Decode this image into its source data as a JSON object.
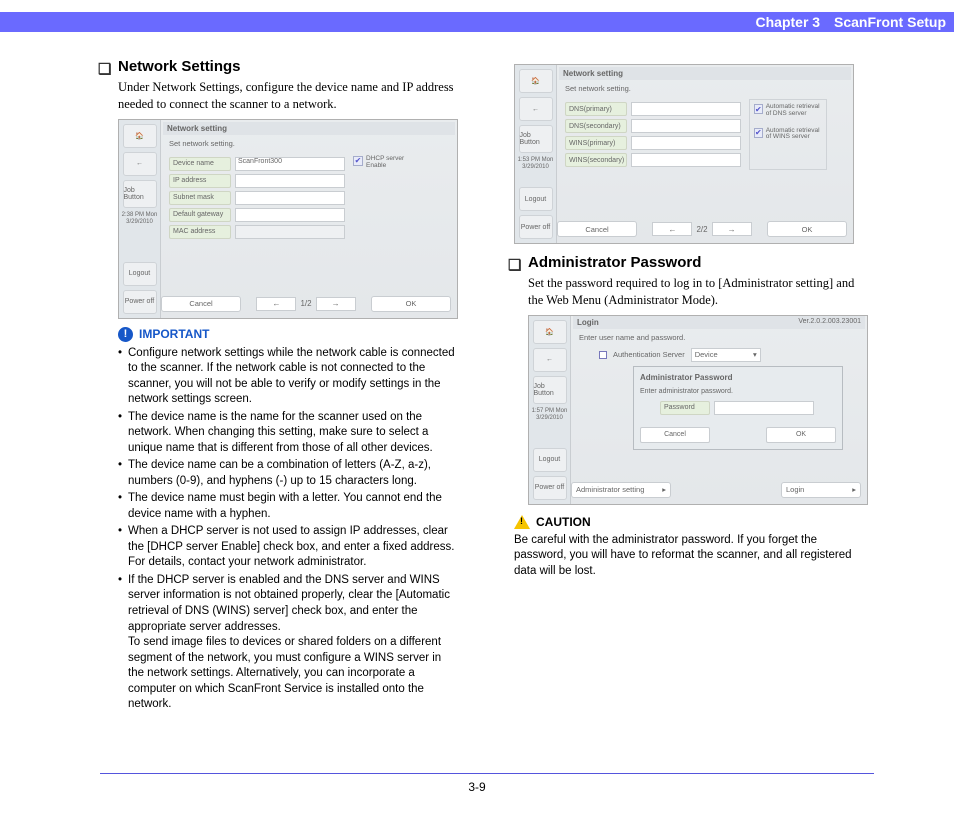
{
  "header": {
    "chapter": "Chapter 3",
    "title": "ScanFront Setup"
  },
  "left": {
    "heading": "Network Settings",
    "intro": "Under Network Settings, configure the device name and IP address needed to connect the scanner to a network.",
    "shot": {
      "title": "Network setting",
      "subtitle": "Set network setting.",
      "sidebar": {
        "home": "Home",
        "job": "Job Button",
        "time": "2:38 PM  Mon 3/29/2010",
        "logout": "Logout",
        "power": "Power off"
      },
      "rows": [
        {
          "label": "Device name",
          "value": "ScanFront300"
        },
        {
          "label": "IP address",
          "value": ""
        },
        {
          "label": "Subnet mask",
          "value": ""
        },
        {
          "label": "Default gateway",
          "value": ""
        },
        {
          "label": "MAC address",
          "value": ""
        }
      ],
      "check": {
        "on": "✔",
        "text": "DHCP server Enable"
      },
      "nav": {
        "prev": "←",
        "page": "1/2",
        "next": "→",
        "cancel": "Cancel",
        "ok": "OK"
      }
    },
    "important_label": "IMPORTANT",
    "bullets": [
      "Configure network settings while the network cable is connected to the scanner. If the network cable is not connected to the scanner, you will not be able to verify or modify settings in the network settings screen.",
      "The device name is the name for the scanner used on the network. When changing this setting, make sure to select a unique name that is different from those of all other devices.",
      "The device name can be a combination of letters (A-Z, a-z), numbers (0-9), and hyphens (-) up to 15 characters long.",
      "The device name must begin with a letter. You cannot end the device name with a hyphen.",
      "When a DHCP server is not used to assign IP addresses, clear the [DHCP server Enable] check box, and enter a fixed address. For details, contact your network administrator.",
      "If the DHCP server is enabled and the DNS server and WINS server information is not obtained properly, clear the [Automatic retrieval of DNS (WINS) server] check box, and enter the appropriate server addresses."
    ],
    "bullet6_extra": "To send image files to devices or shared folders on a different segment of the network, you must configure a WINS server in the network settings. Alternatively, you can incorporate a computer on which ScanFront Service is installed onto the network."
  },
  "right": {
    "shot": {
      "title": "Network setting",
      "subtitle": "Set network setting.",
      "sidebar": {
        "home": "Home",
        "job": "Job Button",
        "time": "1:53 PM  Mon 3/29/2010",
        "logout": "Logout",
        "power": "Power off"
      },
      "rows": [
        {
          "label": "DNS(primary)",
          "value": ""
        },
        {
          "label": "DNS(secondary)",
          "value": ""
        },
        {
          "label": "WINS(primary)",
          "value": ""
        },
        {
          "label": "WINS(secondary)",
          "value": ""
        }
      ],
      "checks": [
        {
          "on": "✔",
          "text": "Automatic retrieval of DNS server"
        },
        {
          "on": "✔",
          "text": "Automatic retrieval of WINS server"
        }
      ],
      "nav": {
        "prev": "←",
        "page": "2/2",
        "next": "→",
        "cancel": "Cancel",
        "ok": "OK"
      }
    },
    "heading": "Administrator Password",
    "intro": "Set the password required to log in to [Administrator setting] and the Web Menu (Administrator Mode).",
    "shot2": {
      "title": "Login",
      "ver": "Ver.2.0.2.003.23001",
      "subtitle": "Enter user name and password.",
      "auth_label": "Authentication Server",
      "auth_val": "Device",
      "dlg_title": "Administrator Password",
      "dlg_sub": "Enter administrator password.",
      "pw_label": "Password",
      "cancel": "Cancel",
      "ok": "OK",
      "admin_btn": "Administrator setting",
      "login_btn": "Login",
      "sidebar": {
        "home": "Home",
        "job": "Job Button",
        "time": "1:57 PM  Mon 3/29/2010",
        "logout": "Logout",
        "power": "Power off"
      }
    },
    "caution_label": "CAUTION",
    "caution_text": "Be careful with the administrator password. If you forget the password, you will have to reformat the scanner, and all registered data will be lost."
  },
  "page_number": "3-9"
}
